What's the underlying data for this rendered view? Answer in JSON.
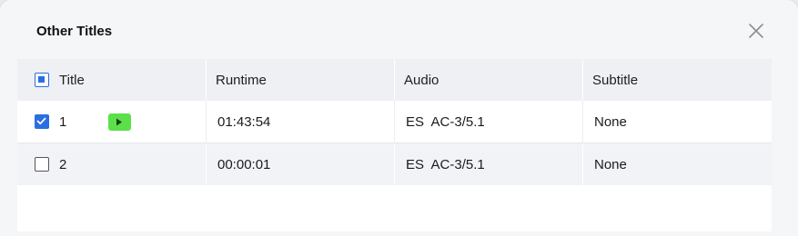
{
  "dialog": {
    "title": "Other Titles",
    "close_icon": "close-icon"
  },
  "table": {
    "columns": [
      "Title",
      "Runtime",
      "Audio",
      "Subtitle"
    ],
    "header_checkbox_state": "indeterminate",
    "rows": [
      {
        "checked": true,
        "title": "1",
        "runtime": "01:43:54",
        "audio": "ES  AC-3/5.1",
        "subtitle": "None",
        "play_icon": "play-icon"
      },
      {
        "checked": false,
        "title": "2",
        "runtime": "00:00:01",
        "audio": "ES  AC-3/5.1",
        "subtitle": "None"
      }
    ]
  },
  "colors": {
    "accent": "#2a6fe0",
    "play": "#5ce04a",
    "header_bg": "#eef0f4",
    "alt_row_bg": "#f1f3f7"
  }
}
